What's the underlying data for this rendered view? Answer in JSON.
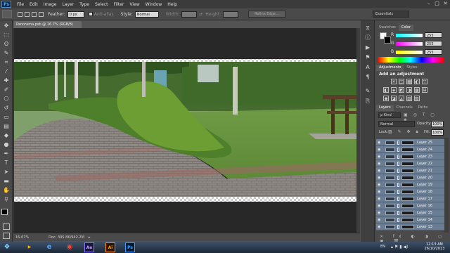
{
  "app": {
    "logo": "Ps"
  },
  "menu": [
    "File",
    "Edit",
    "Image",
    "Layer",
    "Type",
    "Select",
    "Filter",
    "View",
    "Window",
    "Help"
  ],
  "window_controls": {
    "minimize": "–",
    "maximize": "□",
    "close": "✕"
  },
  "options": {
    "feather_label": "Feather:",
    "feather_value": "0 px",
    "antialias_label": "Anti-alias",
    "style_label": "Style:",
    "style_value": "Normal",
    "width_label": "Width:",
    "height_label": "Height:",
    "refine_label": "Refine Edge..."
  },
  "workspace": {
    "value": "Essentials"
  },
  "document": {
    "tab_title": "Panorama.psb @ 16.7% (RGB/8) *",
    "tab_close": "×",
    "zoom": "16.67%",
    "doc_info": "Doc: 395.8K/942.2M"
  },
  "tools": [
    {
      "name": "move-tool",
      "glyph": "✥"
    },
    {
      "name": "marquee-tool",
      "glyph": "⬚"
    },
    {
      "name": "lasso-tool",
      "glyph": "ʘ"
    },
    {
      "name": "quick-select-tool",
      "glyph": "✎"
    },
    {
      "name": "crop-tool",
      "glyph": "⌗"
    },
    {
      "name": "eyedropper-tool",
      "glyph": "⁄"
    },
    {
      "name": "healing-tool",
      "glyph": "✚"
    },
    {
      "name": "brush-tool",
      "glyph": "✐"
    },
    {
      "name": "clone-tool",
      "glyph": "⎔"
    },
    {
      "name": "history-brush-tool",
      "glyph": "↺"
    },
    {
      "name": "eraser-tool",
      "glyph": "▭"
    },
    {
      "name": "gradient-tool",
      "glyph": "▤"
    },
    {
      "name": "blur-tool",
      "glyph": "◆"
    },
    {
      "name": "dodge-tool",
      "glyph": "●"
    },
    {
      "name": "pen-tool",
      "glyph": "✒"
    },
    {
      "name": "type-tool",
      "glyph": "T"
    },
    {
      "name": "path-select-tool",
      "glyph": "➤"
    },
    {
      "name": "shape-tool",
      "glyph": "▬"
    },
    {
      "name": "hand-tool",
      "glyph": "✋"
    },
    {
      "name": "zoom-tool",
      "glyph": "⚲"
    }
  ],
  "panels": {
    "color_tabs": [
      "Swatches",
      "Color"
    ],
    "color": {
      "r_label": "R",
      "g_label": "G",
      "b_label": "B",
      "r": "255",
      "g": "255",
      "b": "255"
    },
    "adjust_tabs": [
      "Adjustments",
      "Styles"
    ],
    "adjust_title": "Add an adjustment",
    "adjust_icons": [
      "☀",
      "◫",
      "▦",
      "◐",
      "▽",
      "◧",
      "◈",
      "◩",
      "◑",
      "▩",
      "⊞",
      "◉",
      "◪",
      "◭",
      "▧",
      "▨"
    ],
    "layer_tabs": [
      "Layers",
      "Channels",
      "Paths"
    ],
    "filter_kind": "ρ Kind",
    "blend_mode": "Normal",
    "opacity_label": "Opacity:",
    "opacity_value": "100%",
    "lock_label": "Lock:",
    "fill_label": "Fill:",
    "fill_value": "100%",
    "layers": [
      "Layer 25",
      "Layer 24",
      "Layer 23",
      "Layer 22",
      "Layer 21",
      "Layer 20",
      "Layer 19",
      "Layer 18",
      "Layer 17",
      "Layer 16",
      "Layer 15",
      "Layer 14",
      "Layer 13"
    ]
  },
  "taskbar": {
    "apps": [
      {
        "name": "windows-start",
        "label": "❖"
      },
      {
        "name": "media-player",
        "label": "▶"
      },
      {
        "name": "ie",
        "label": "e"
      },
      {
        "name": "chrome",
        "label": "◉"
      },
      {
        "name": "after-effects",
        "label": "Ae"
      },
      {
        "name": "illustrator",
        "label": "Ai"
      },
      {
        "name": "photoshop",
        "label": "Ps"
      }
    ],
    "lang": "EN",
    "time": "12:13 AM",
    "date": "26/10/2013"
  }
}
